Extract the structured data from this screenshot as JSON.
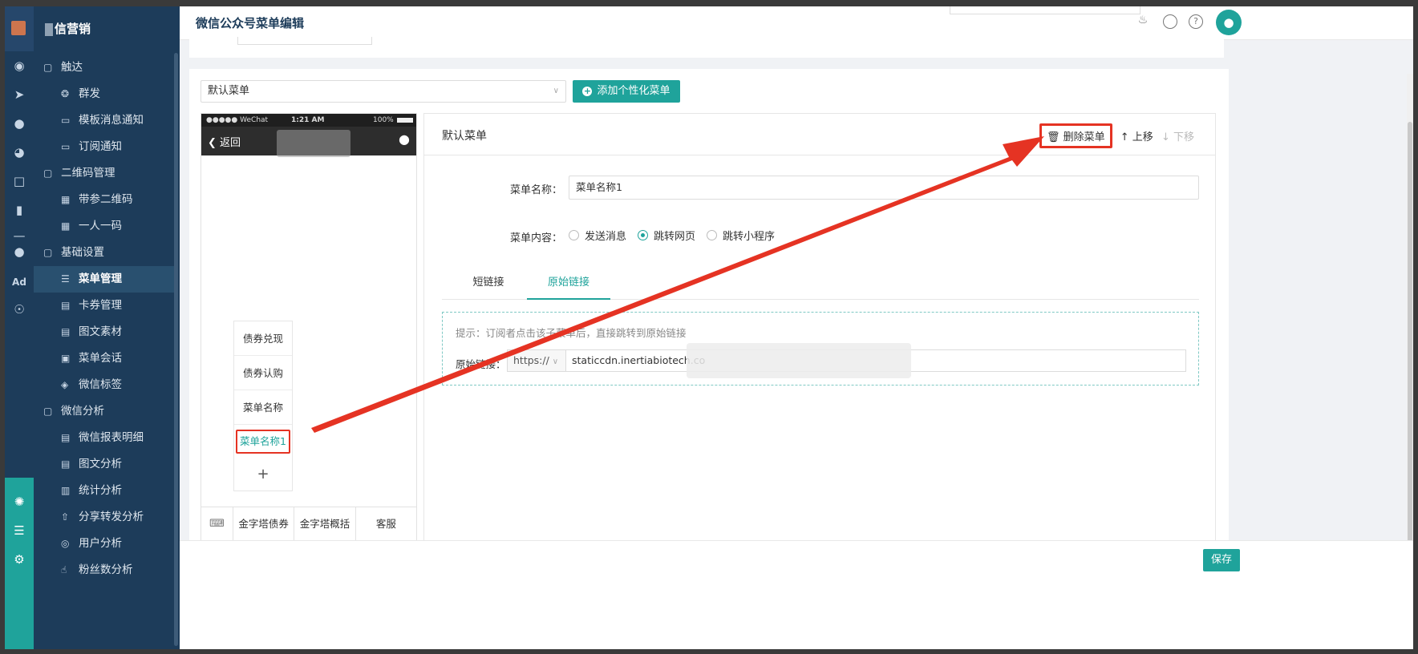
{
  "brand": {
    "name": "信营销"
  },
  "header": {
    "title": "微信公众号菜单编辑"
  },
  "sidebar": {
    "items": [
      {
        "label": "触达",
        "type": "group",
        "icon": "folder-icon"
      },
      {
        "label": "群发",
        "type": "item",
        "icon": "broadcast-icon"
      },
      {
        "label": "模板消息通知",
        "type": "item",
        "icon": "message-icon"
      },
      {
        "label": "订阅通知",
        "type": "item",
        "icon": "message-icon"
      },
      {
        "label": "二维码管理",
        "type": "group",
        "icon": "folder-icon"
      },
      {
        "label": "带参二维码",
        "type": "item",
        "icon": "qrcode-icon"
      },
      {
        "label": "一人一码",
        "type": "item",
        "icon": "qrcode-icon"
      },
      {
        "label": "基础设置",
        "type": "group",
        "icon": "folder-icon"
      },
      {
        "label": "菜单管理",
        "type": "item",
        "icon": "list-icon",
        "active": true
      },
      {
        "label": "卡券管理",
        "type": "item",
        "icon": "coupon-icon"
      },
      {
        "label": "图文素材",
        "type": "item",
        "icon": "document-icon"
      },
      {
        "label": "菜单会话",
        "type": "item",
        "icon": "chat-icon"
      },
      {
        "label": "微信标签",
        "type": "item",
        "icon": "tag-icon"
      },
      {
        "label": "微信分析",
        "type": "group",
        "icon": "folder-icon"
      },
      {
        "label": "微信报表明细",
        "type": "item",
        "icon": "document-icon"
      },
      {
        "label": "图文分析",
        "type": "item",
        "icon": "document-icon"
      },
      {
        "label": "统计分析",
        "type": "item",
        "icon": "chart-icon"
      },
      {
        "label": "分享转发分析",
        "type": "item",
        "icon": "share-icon"
      },
      {
        "label": "用户分析",
        "type": "item",
        "icon": "user-scan-icon"
      },
      {
        "label": "粉丝数分析",
        "type": "item",
        "icon": "thumbs-up-icon"
      }
    ]
  },
  "rail": {
    "ad_label": "Ad"
  },
  "toolbar": {
    "menu_select": "默认菜单",
    "add_button": "添加个性化菜单"
  },
  "phone": {
    "status_left": "●●●●● WeChat",
    "status_time": "1:21 AM",
    "status_battery": "100%",
    "back_label": "返回",
    "submenu": [
      "债券兑现",
      "债券认购",
      "菜单名称",
      "菜单名称1"
    ],
    "submenu_add": "+",
    "bottom_menus": [
      "金字塔债券",
      "金字塔概括",
      "客服"
    ]
  },
  "editor": {
    "title": "默认菜单",
    "delete_label": "删除菜单",
    "move_up_label": "上移",
    "move_down_label": "下移",
    "name_label": "菜单名称：",
    "name_value": "菜单名称1",
    "content_label": "菜单内容：",
    "content_options": [
      "发送消息",
      "跳转网页",
      "跳转小程序"
    ],
    "content_selected": "跳转网页",
    "tabs": [
      "短链接",
      "原始链接"
    ],
    "active_tab": "原始链接",
    "tip": "提示：订阅者点击该子菜单后，直接跳转到原始链接",
    "link_label": "原始链接：",
    "protocol": "https://",
    "url_value": "staticcdn.inertiabiotech.co"
  },
  "footer": {
    "save_label": "保存"
  },
  "colors": {
    "accent": "#1fa39b",
    "sidebar": "#1d3c5a",
    "annotation": "#e53323"
  }
}
